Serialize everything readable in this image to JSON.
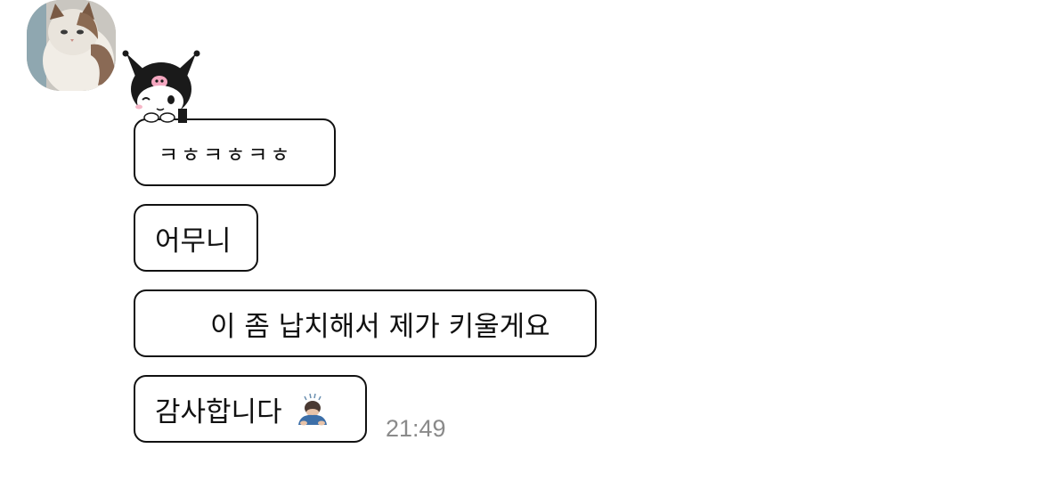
{
  "avatar": {
    "icon": "cat-avatar-icon"
  },
  "sticker": {
    "icon": "kuromi-sticker-icon"
  },
  "messages": [
    {
      "text": "ㅋㅎㅋㅎㅋㅎ"
    },
    {
      "text": "어무니"
    },
    {
      "text": "이 좀 납치해서 제가 키울게요"
    },
    {
      "text": "감사합니다",
      "emoji": "bowing-person-icon"
    }
  ],
  "timestamp": "21:49"
}
